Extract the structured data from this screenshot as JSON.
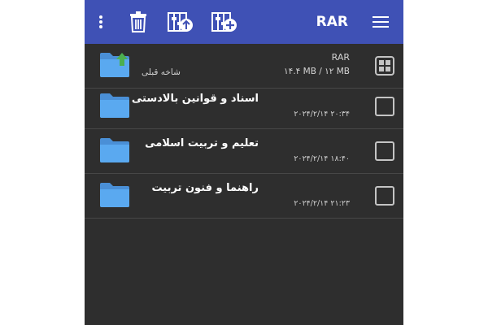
{
  "appbar": {
    "title": "RAR",
    "color": "#3f51b5",
    "icons": [
      "more-vert-icon",
      "trash-icon",
      "extract-icon",
      "add-to-archive-icon",
      "menu-icon"
    ]
  },
  "parent_row": {
    "archive_label": "RAR",
    "size": "۱۴.۴ MB / ۱۲ MB",
    "label": "شاخه قبلی"
  },
  "files": [
    {
      "name": "اسناد و قوانین بالادستی",
      "date": "۲۰۲۴/۲/۱۴ ۲۰:۳۴"
    },
    {
      "name": "تعلیم و تربیت اسلامی",
      "date": "۲۰۲۴/۲/۱۴ ۱۸:۴۰"
    },
    {
      "name": "راهنما و فنون تربیت",
      "date": "۲۰۲۴/۲/۱۴ ۲۱:۲۳"
    }
  ],
  "colors": {
    "background": "#2e2e2e",
    "folder": "#5aa9f0",
    "folder_back": "#4a8fd6",
    "up_arrow": "#4caf50"
  }
}
